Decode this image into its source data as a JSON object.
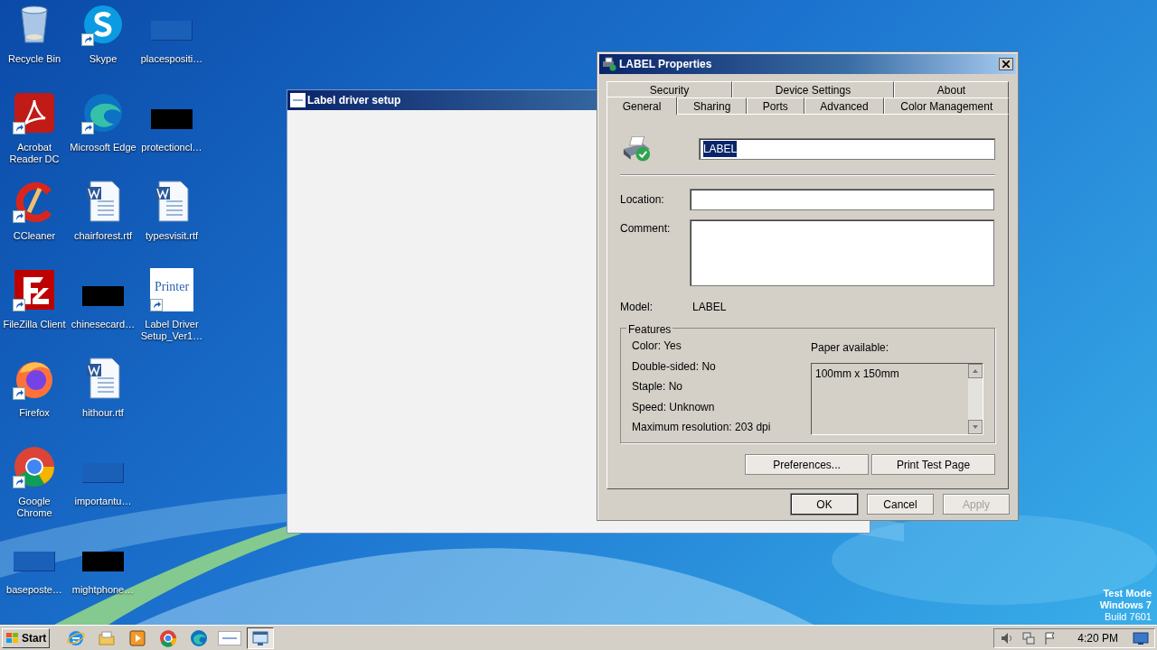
{
  "desktop_icons": [
    {
      "label": "Recycle Bin",
      "kind": "recycle",
      "shortcut": false
    },
    {
      "label": "Acrobat Reader DC",
      "kind": "acrobat",
      "shortcut": true
    },
    {
      "label": "CCleaner",
      "kind": "ccleaner",
      "shortcut": true
    },
    {
      "label": "FileZilla Client",
      "kind": "filezilla",
      "shortcut": true
    },
    {
      "label": "Firefox",
      "kind": "firefox",
      "shortcut": true
    },
    {
      "label": "Google Chrome",
      "kind": "chrome",
      "shortcut": true
    },
    {
      "label": "baseposte…",
      "kind": "blank",
      "shortcut": false
    },
    {
      "label": "Skype",
      "kind": "skype",
      "shortcut": true
    },
    {
      "label": "Microsoft Edge",
      "kind": "edge",
      "shortcut": true
    },
    {
      "label": "chairforest.rtf",
      "kind": "word",
      "shortcut": false
    },
    {
      "label": "chinesecard…",
      "kind": "black",
      "shortcut": false
    },
    {
      "label": "hithour.rtf",
      "kind": "word",
      "shortcut": false
    },
    {
      "label": "importantu…",
      "kind": "blank",
      "shortcut": false
    },
    {
      "label": "mightphone…",
      "kind": "black",
      "shortcut": false
    },
    {
      "label": "placespositi…",
      "kind": "blank",
      "shortcut": false
    },
    {
      "label": "protectioncl…",
      "kind": "black",
      "shortcut": false
    },
    {
      "label": "typesvisit.rtf",
      "kind": "word",
      "shortcut": false
    },
    {
      "label": "Label Driver Setup_Ver1…",
      "kind": "printer",
      "shortcut": true,
      "icon_text": "Printer"
    }
  ],
  "setup_window": {
    "title": "Label driver setup"
  },
  "dialog": {
    "title": "LABEL Properties",
    "tab_rows": [
      [
        {
          "label": "Security",
          "selected": false
        },
        {
          "label": "Device Settings",
          "selected": false
        },
        {
          "label": "About",
          "selected": false
        }
      ],
      [
        {
          "label": "General",
          "selected": true
        },
        {
          "label": "Sharing",
          "selected": false
        },
        {
          "label": "Ports",
          "selected": false
        },
        {
          "label": "Advanced",
          "selected": false
        },
        {
          "label": "Color Management",
          "selected": false
        }
      ]
    ],
    "printer_name": {
      "value": "LABEL",
      "selected": true
    },
    "location": {
      "label": "Location:"
    },
    "comment": {
      "label": "Comment:"
    },
    "model": {
      "label": "Model:",
      "value": "LABEL"
    },
    "features": {
      "title": "Features",
      "items": [
        "Color: Yes",
        "Double-sided: No",
        "Staple: No",
        "Speed: Unknown",
        "Maximum resolution: 203 dpi"
      ],
      "paper_label": "Paper available:",
      "paper": [
        "100mm x 150mm"
      ]
    },
    "panel_buttons": [
      {
        "label": "Preferences...",
        "disabled": false
      },
      {
        "label": "Print Test Page",
        "disabled": false
      }
    ],
    "buttons": [
      {
        "label": "OK",
        "disabled": false,
        "default": true
      },
      {
        "label": "Cancel",
        "disabled": false,
        "default": false
      },
      {
        "label": "Apply",
        "disabled": true,
        "default": false
      }
    ]
  },
  "watermark_text": [
    "Test Mode",
    "Windows 7",
    "Build 7601"
  ],
  "taskbar": {
    "start": "Start",
    "items": [
      {
        "kind": "ie",
        "selected": false
      },
      {
        "kind": "folder",
        "selected": false
      },
      {
        "kind": "media",
        "selected": false
      },
      {
        "kind": "chrome",
        "selected": false
      },
      {
        "kind": "edge",
        "selected": false
      },
      {
        "kind": "printer",
        "selected": false
      },
      {
        "kind": "window",
        "selected": true
      }
    ],
    "clock": "4:20 PM"
  }
}
